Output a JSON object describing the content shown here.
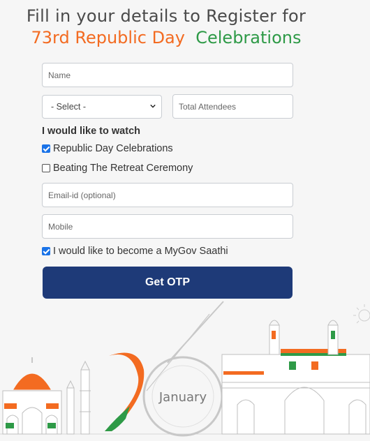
{
  "heading": {
    "line1": "Fill in your details to Register for",
    "line2_orange": "73rd Republic Day",
    "line2_green": "Celebrations"
  },
  "form": {
    "name_placeholder": "Name",
    "select_value": "- Select -",
    "attendees_placeholder": "Total Attendees",
    "watch_label": "I would like to watch",
    "options": [
      {
        "label": "Republic Day Celebrations",
        "checked": true
      },
      {
        "label": "Beating The Retreat Ceremony",
        "checked": false
      }
    ],
    "email_placeholder": "Email-id (optional)",
    "mobile_placeholder": "Mobile",
    "saathi_label": "I would like to become a MyGov Saathi",
    "saathi_checked": true,
    "submit_label": "Get OTP"
  },
  "illustration": {
    "month": "January"
  },
  "colors": {
    "saffron": "#f36b21",
    "green": "#2e9a47",
    "button": "#1e3a78",
    "checkbox": "#1a73e8"
  }
}
